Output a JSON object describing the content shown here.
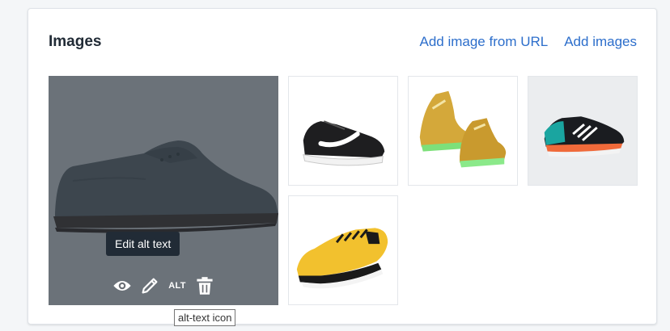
{
  "card": {
    "title": "Images",
    "links": {
      "add_from_url": "Add image from URL",
      "add_images": "Add images"
    }
  },
  "images": [
    {
      "name": "grey-suede-shoe",
      "selected": true
    },
    {
      "name": "black-white-sneaker"
    },
    {
      "name": "gold-light-up-sneaker"
    },
    {
      "name": "black-teal-running-shoe"
    },
    {
      "name": "yellow-human-race-sneaker"
    }
  ],
  "actions": {
    "preview_icon": "eye-icon",
    "edit_icon": "pencil-icon",
    "alt_label": "ALT",
    "delete_icon": "trash-icon"
  },
  "tooltip": {
    "label": "Edit alt text"
  },
  "hover_hint": {
    "label": "alt-text icon"
  },
  "colors": {
    "link": "#2c6ecb",
    "heading": "#212b36",
    "overlay": "#212b36"
  }
}
